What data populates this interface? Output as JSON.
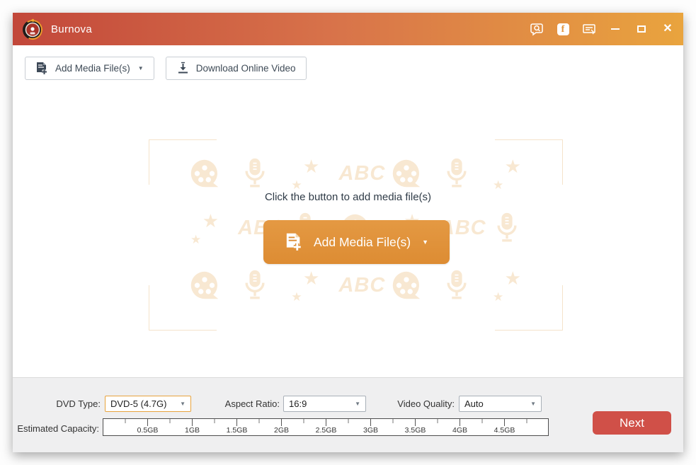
{
  "window": {
    "title": "Burnova"
  },
  "titlebar": {
    "icons": [
      "feedback-chat-search",
      "facebook",
      "feedback-form",
      "minimize",
      "maximize",
      "close"
    ],
    "facebook_letter": "f",
    "close_glyph": "✕"
  },
  "toolbar": {
    "add_media_label": "Add Media File(s)",
    "download_label": "Download Online Video"
  },
  "main": {
    "empty_hint": "Click the button to add media file(s)",
    "add_media_button_label": "Add Media File(s)",
    "watermark_abc": "ABC",
    "watermark_star": "★"
  },
  "footer": {
    "dvd_type_label": "DVD Type:",
    "dvd_type_value": "DVD-5 (4.7G)",
    "aspect_ratio_label": "Aspect Ratio:",
    "aspect_ratio_value": "16:9",
    "video_quality_label": "Video Quality:",
    "video_quality_value": "Auto",
    "estimated_capacity_label": "Estimated Capacity:",
    "capacity_ticks": [
      "0.5GB",
      "1GB",
      "1.5GB",
      "2GB",
      "2.5GB",
      "3GB",
      "3.5GB",
      "4GB",
      "4.5GB"
    ],
    "next_label": "Next"
  },
  "colors": {
    "titlebar_gradient_left": "#c2473a",
    "titlebar_gradient_right": "#e9a43e",
    "accent_orange": "#e2943c",
    "highlight_border": "#e8a33d",
    "next_red": "#d05048",
    "watermark": "#f8e8d2"
  }
}
